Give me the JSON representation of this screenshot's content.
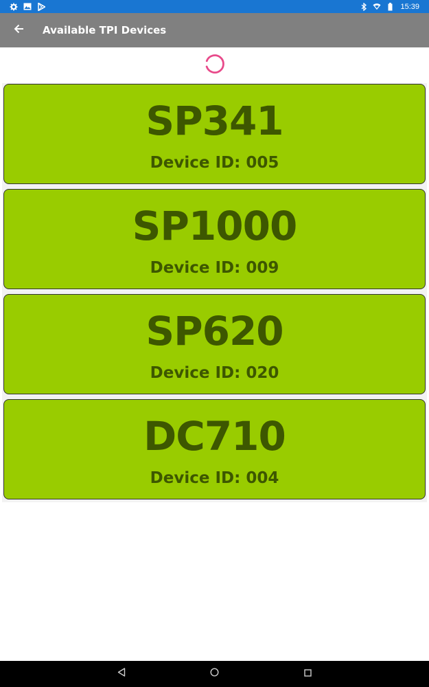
{
  "status_bar": {
    "time": "15:39",
    "left_icons": [
      "settings-icon",
      "image-icon",
      "play-store-icon"
    ],
    "right_icons": [
      "bluetooth-icon",
      "wifi-icon",
      "battery-icon"
    ]
  },
  "app_bar": {
    "title": "Available TPI Devices",
    "back_icon": "arrow-left-icon"
  },
  "loading": {
    "indicator": "spinner-icon",
    "color": "#e84a8a"
  },
  "devices": [
    {
      "name": "SP341",
      "id_label": "Device ID: 005"
    },
    {
      "name": "SP1000",
      "id_label": "Device ID: 009"
    },
    {
      "name": "SP620",
      "id_label": "Device ID: 020"
    },
    {
      "name": "DC710",
      "id_label": "Device ID: 004"
    }
  ],
  "colors": {
    "status_bar": "#1976d2",
    "app_bar": "#808080",
    "card_background": "#99cc00",
    "card_text": "#3d5700"
  },
  "nav_bar": {
    "buttons": [
      "back-triangle-icon",
      "home-circle-icon",
      "recents-square-icon"
    ]
  }
}
